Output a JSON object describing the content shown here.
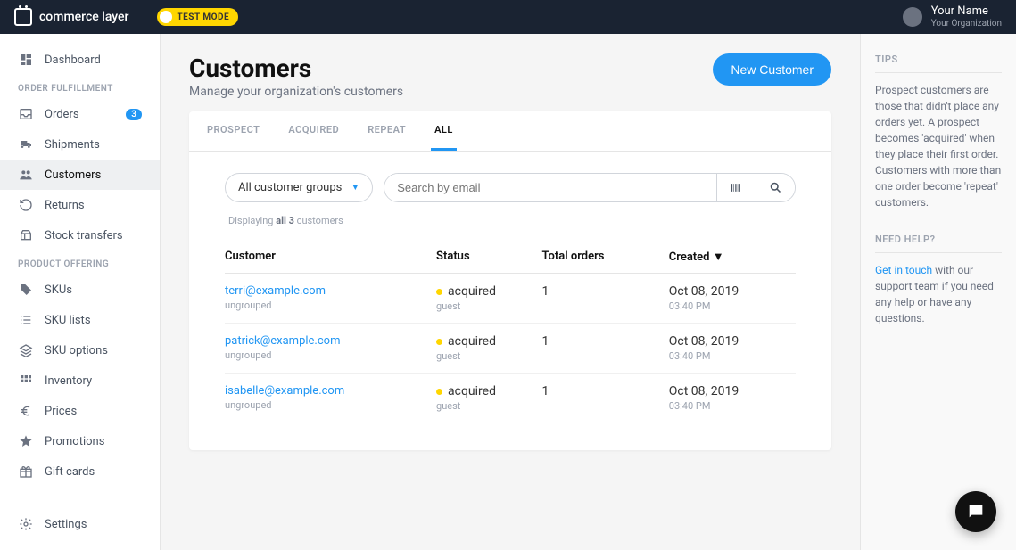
{
  "header": {
    "brand": "commerce layer",
    "test_mode": "TEST MODE",
    "user_name": "Your Name",
    "user_org": "Your Organization"
  },
  "sidebar": {
    "dashboard": "Dashboard",
    "section_order": "ORDER FULFILLMENT",
    "orders": "Orders",
    "orders_badge": "3",
    "shipments": "Shipments",
    "customers": "Customers",
    "returns": "Returns",
    "stock_transfers": "Stock transfers",
    "section_product": "PRODUCT OFFERING",
    "skus": "SKUs",
    "sku_lists": "SKU lists",
    "sku_options": "SKU options",
    "inventory": "Inventory",
    "prices": "Prices",
    "promotions": "Promotions",
    "gift_cards": "Gift cards",
    "settings": "Settings"
  },
  "page": {
    "title": "Customers",
    "subtitle": "Manage your organization's customers",
    "new_button": "New Customer",
    "tabs": {
      "prospect": "PROSPECT",
      "acquired": "ACQUIRED",
      "repeat": "REPEAT",
      "all": "ALL"
    },
    "group_filter": "All customer groups",
    "search_placeholder": "Search by email",
    "displaying_prefix": "Displaying ",
    "displaying_bold": "all 3",
    "displaying_suffix": " customers",
    "columns": {
      "customer": "Customer",
      "status": "Status",
      "total_orders": "Total orders",
      "created": "Created ▼"
    },
    "rows": [
      {
        "email": "terri@example.com",
        "group": "ungrouped",
        "status": "acquired",
        "role": "guest",
        "orders": "1",
        "date": "Oct 08, 2019",
        "time": "03:40 PM"
      },
      {
        "email": "patrick@example.com",
        "group": "ungrouped",
        "status": "acquired",
        "role": "guest",
        "orders": "1",
        "date": "Oct 08, 2019",
        "time": "03:40 PM"
      },
      {
        "email": "isabelle@example.com",
        "group": "ungrouped",
        "status": "acquired",
        "role": "guest",
        "orders": "1",
        "date": "Oct 08, 2019",
        "time": "03:40 PM"
      }
    ]
  },
  "rightbar": {
    "tips_title": "TIPS",
    "tips_body": "Prospect customers are those that didn't place any orders yet. A prospect becomes 'acquired' when they place their first order. Customers with more than one order become 'repeat' customers.",
    "help_title": "NEED HELP?",
    "help_link": "Get in touch",
    "help_body": " with our support team if you need any help or have any questions."
  }
}
